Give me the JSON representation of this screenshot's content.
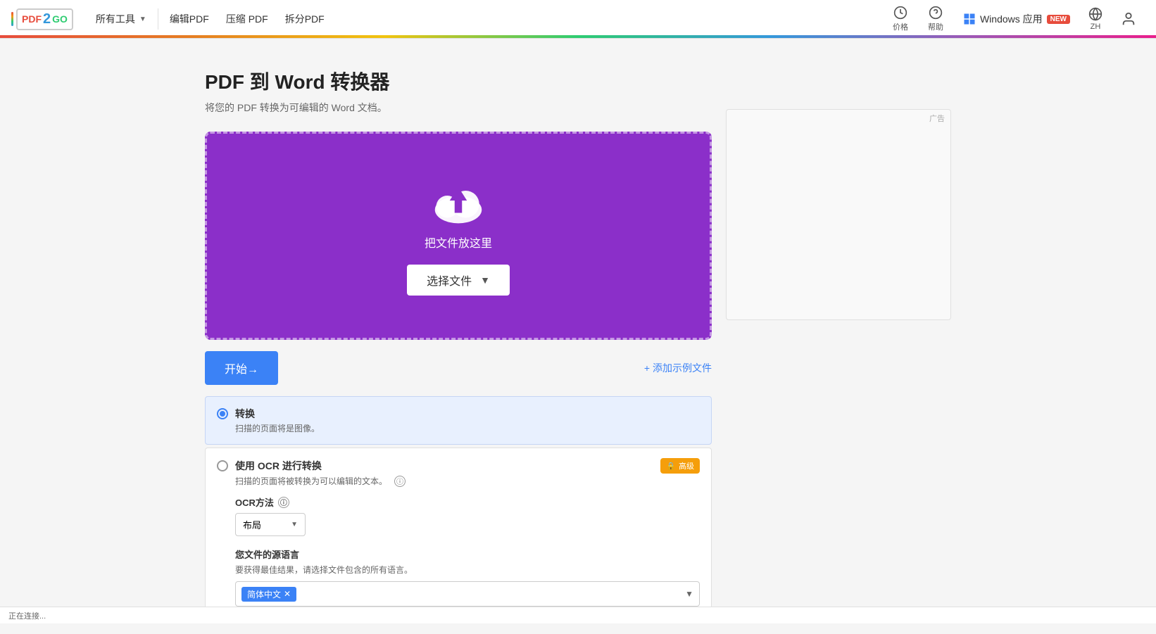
{
  "logo": {
    "pdf": "PDF",
    "two": "2",
    "go": "GO"
  },
  "nav": {
    "tools_label": "所有工具",
    "edit_pdf": "编辑PDF",
    "compress_pdf": "压缩 PDF",
    "split_pdf": "拆分PDF",
    "price_label": "价格",
    "help_label": "帮助",
    "windows_app": "Windows 应用",
    "new_badge": "New",
    "lang": "ZH"
  },
  "page": {
    "title": "PDF 到 Word 转换器",
    "subtitle": "将您的 PDF 转换为可编辑的 Word 文档。"
  },
  "upload": {
    "drop_text": "把文件放这里",
    "choose_file": "选择文件"
  },
  "actions": {
    "start": "开始→",
    "add_sample": "+ 添加示例文件"
  },
  "options": {
    "convert": {
      "label": "转换",
      "desc": "扫描的页面将是图像。"
    },
    "ocr": {
      "label": "使用 OCR 进行转换",
      "desc": "扫描的页面将被转换为可以编辑的文本。",
      "premium": "高级",
      "ocr_method_label": "OCR方法",
      "ocr_method_value": "布局",
      "source_lang_label": "您文件的源语言",
      "source_lang_desc": "要获得最佳结果，请选择文件包含的所有语言。",
      "lang_tag": "简体中文"
    }
  },
  "ad": {
    "label": "广告"
  },
  "status": {
    "text": "正在连接..."
  }
}
